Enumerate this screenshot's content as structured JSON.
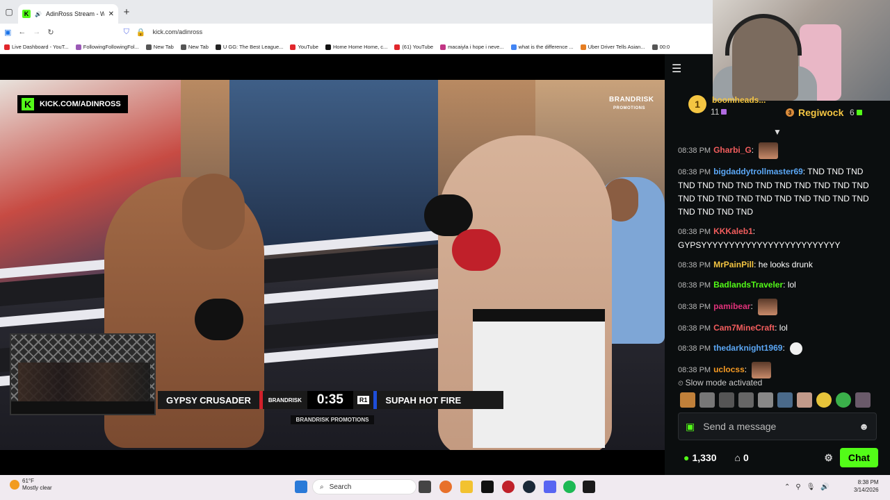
{
  "browser": {
    "tab_title": "AdinRoss Stream - Watch Li",
    "url": "kick.com/adinross",
    "bookmarks": [
      {
        "label": "Live Dashboard - YouT...",
        "color": "#e1262c"
      },
      {
        "label": "FollowingFollowingFol...",
        "color": "#9b59b6"
      },
      {
        "label": "New Tab",
        "color": "#555"
      },
      {
        "label": "New Tab",
        "color": "#555"
      },
      {
        "label": "U GG: The Best League...",
        "color": "#222"
      },
      {
        "label": "YouTube",
        "color": "#e1262c"
      },
      {
        "label": "Home Home Home, c...",
        "color": "#111"
      },
      {
        "label": "(61) YouTube",
        "color": "#e1262c"
      },
      {
        "label": "macaiyla i hope i neve...",
        "color": "#c13584"
      },
      {
        "label": "what is the difference ...",
        "color": "#4285f4"
      },
      {
        "label": "Uber Driver Tells Asian...",
        "color": "#e67e22"
      },
      {
        "label": "00:0",
        "color": "#555"
      }
    ]
  },
  "stream": {
    "channel_badge": "KICK.COM/ADINROSS",
    "brand_logo": "BRANDRISK",
    "brand_logo_sub": "PROMOTIONS",
    "score": {
      "red_fighter": "GYPSY CRUSADER",
      "brand": "BRANDRISK",
      "time": "0:35",
      "round": "R1",
      "blue_fighter": "SUPAH HOT FIRE"
    },
    "promo": "BRANDRISK PROMOTIONS"
  },
  "leaderboard": {
    "first_rank": "1",
    "first_name": "boomheads...",
    "first_count": "11",
    "third_rank": "3",
    "third_name": "Regiwock",
    "third_count": "6"
  },
  "chat": {
    "messages": [
      {
        "time": "08:38 PM",
        "user": "Gharbi_G",
        "color": "#f25d5d",
        "text": "",
        "emote": "brown"
      },
      {
        "time": "08:38 PM",
        "user": "bigdaddytrollmaster69",
        "color": "#5ba7f5",
        "text": "TND TND TND TND TND TND TND TND TND TND TND TND TND TND TND TND TND TND TND TND TND TND TND TND TND TND TND",
        "emote": ""
      },
      {
        "time": "08:38 PM",
        "user": "KKKaleb1",
        "color": "#f25d5d",
        "text": "GYPSYYYYYYYYYYYYYYYYYYYYYYYYY",
        "emote": ""
      },
      {
        "time": "08:38 PM",
        "user": "MrPainPill",
        "color": "#f4c542",
        "text": "he looks drunk",
        "emote": ""
      },
      {
        "time": "08:38 PM",
        "user": "BadlandsTraveler",
        "color": "#53fc18",
        "text": "lol",
        "emote": ""
      },
      {
        "time": "08:38 PM",
        "user": "pamibear",
        "color": "#e0327a",
        "text": "",
        "emote": "brown"
      },
      {
        "time": "08:38 PM",
        "user": "Cam7MineCraft",
        "color": "#f25d5d",
        "text": "lol",
        "emote": ""
      },
      {
        "time": "08:38 PM",
        "user": "thedarknight1969",
        "color": "#5ba7f5",
        "text": "",
        "emote": "white"
      },
      {
        "time": "08:38 PM",
        "user": "uclocss",
        "color": "#f59a23",
        "text": "",
        "emote": "brown"
      }
    ],
    "slow_mode": "Slow mode activated",
    "input_placeholder": "Send a message",
    "points": "1,330",
    "bag_count": "0",
    "chat_button": "Chat"
  },
  "taskbar": {
    "weather_temp": "61°F",
    "weather_desc": "Mostly clear",
    "search_label": "Search",
    "time": "8:38 PM",
    "date": "3/14/2026"
  }
}
